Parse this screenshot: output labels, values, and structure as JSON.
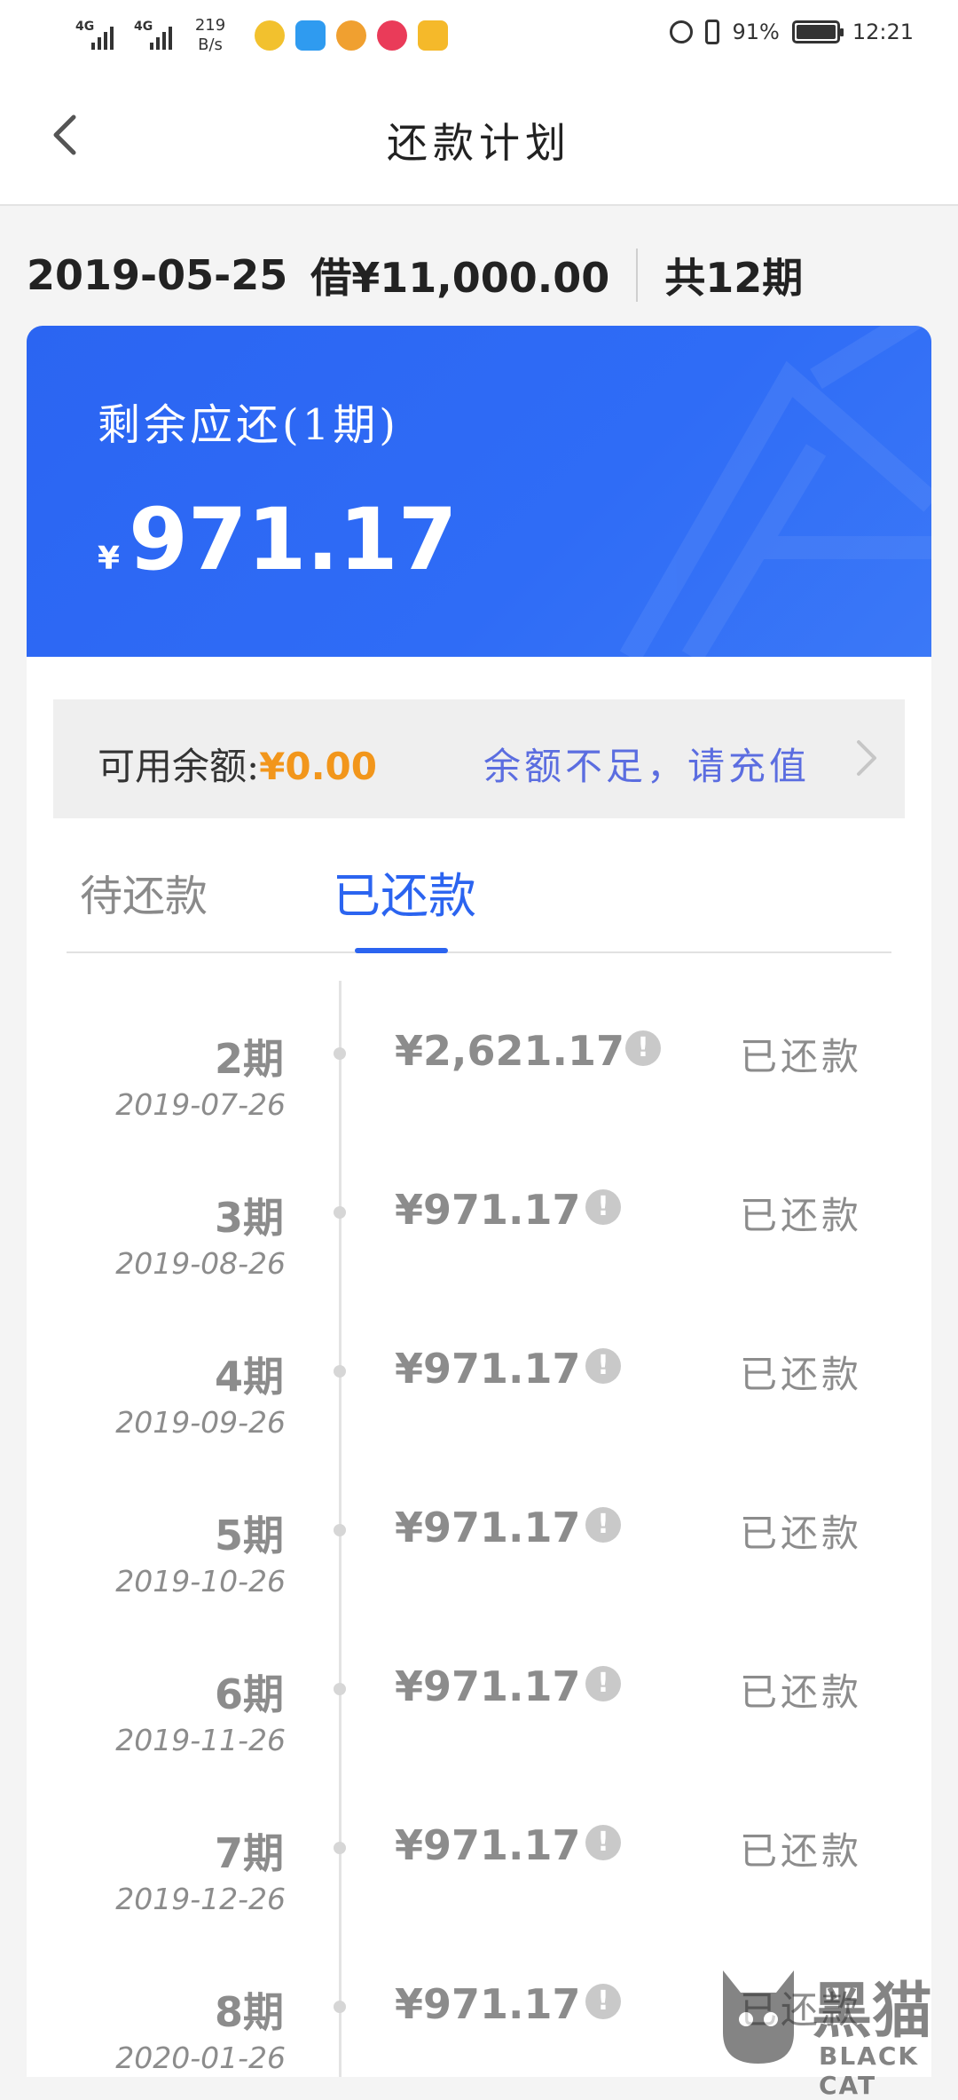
{
  "status_bar": {
    "signal1": "4G",
    "signal2": "4G",
    "speed_value": "219",
    "speed_unit": "B/s",
    "battery": "91%",
    "time": "12:21"
  },
  "header": {
    "title": "还款计划"
  },
  "summary": {
    "date": "2019-05-25",
    "loan": "借¥11,000.00",
    "terms": "共12期"
  },
  "card": {
    "label": "剩余应还(1期)",
    "currency": "¥",
    "amount": "971.17"
  },
  "balance": {
    "label": "可用余额:",
    "value": "¥0.00",
    "recharge": "余额不足，请充值"
  },
  "tabs": [
    {
      "label": "待还款",
      "active": false
    },
    {
      "label": "已还款",
      "active": true
    }
  ],
  "installments": [
    {
      "period": "2期",
      "date": "2019-07-26",
      "amount": "¥2,621.17",
      "status": "已还款"
    },
    {
      "period": "3期",
      "date": "2019-08-26",
      "amount": "¥971.17",
      "status": "已还款"
    },
    {
      "period": "4期",
      "date": "2019-09-26",
      "amount": "¥971.17",
      "status": "已还款"
    },
    {
      "period": "5期",
      "date": "2019-10-26",
      "amount": "¥971.17",
      "status": "已还款"
    },
    {
      "period": "6期",
      "date": "2019-11-26",
      "amount": "¥971.17",
      "status": "已还款"
    },
    {
      "period": "7期",
      "date": "2019-12-26",
      "amount": "¥971.17",
      "status": "已还款"
    },
    {
      "period": "8期",
      "date": "2020-01-26",
      "amount": "¥971.17",
      "status": "已还款"
    }
  ],
  "watermark": {
    "cn": "黑猫",
    "en": "BLACK CAT"
  },
  "colors": {
    "accent": "#2b64f0",
    "card_blue": "#2f6cf6",
    "balance_orange": "#f2961b",
    "recharge_link": "#5b6de0"
  }
}
